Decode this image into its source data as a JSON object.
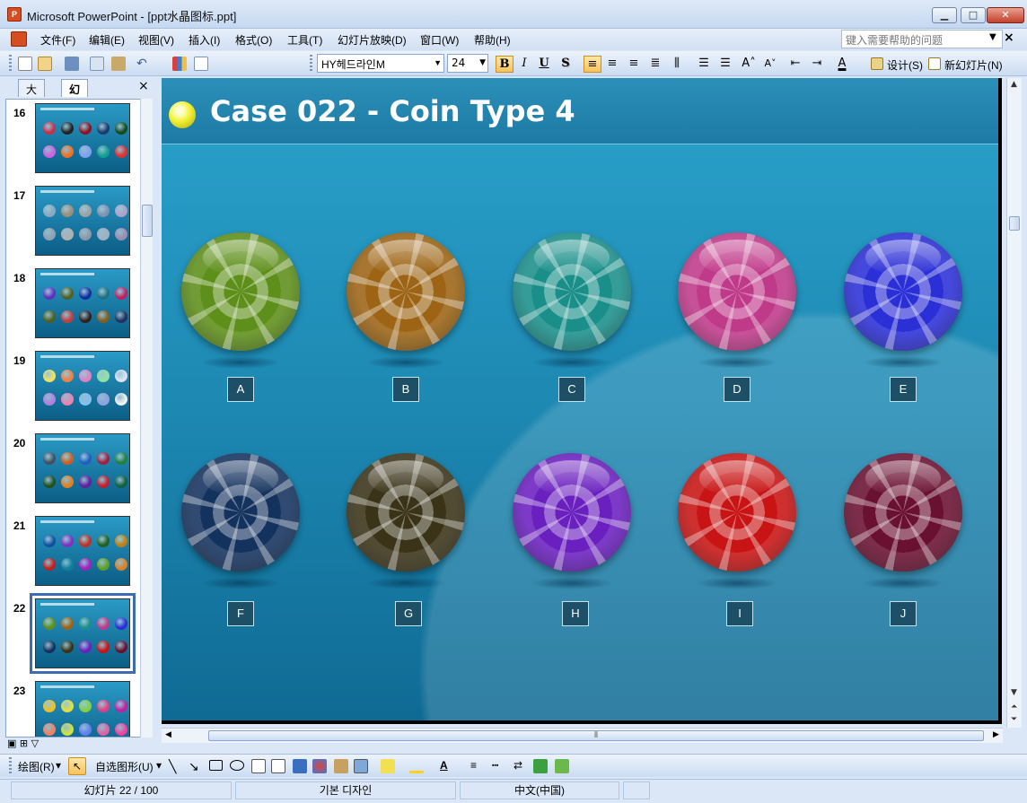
{
  "window": {
    "title": "Microsoft PowerPoint - [ppt水晶图标.ppt]",
    "app_icon": "powerpoint-icon",
    "buttons": {
      "minimize": "▁",
      "maximize": "□",
      "close": "✕"
    }
  },
  "menu": {
    "items": [
      "文件(F)",
      "编辑(E)",
      "视图(V)",
      "插入(I)",
      "格式(O)",
      "工具(T)",
      "幻灯片放映(D)",
      "窗口(W)",
      "帮助(H)"
    ],
    "help_placeholder": "键入需要帮助的问题",
    "close_glyph": "×"
  },
  "toolbar": {
    "font_name": "HY헤드라인M",
    "font_size": "24",
    "bold": "B",
    "italic": "I",
    "underline": "U",
    "shadow": "S",
    "design_label": "设计(S)",
    "new_slide_label": "新幻灯片(N)"
  },
  "panel": {
    "tabs": [
      "大纲",
      "幻灯片"
    ],
    "close_glyph": "×",
    "slides": [
      {
        "number": "16"
      },
      {
        "number": "17"
      },
      {
        "number": "18"
      },
      {
        "number": "19"
      },
      {
        "number": "20"
      },
      {
        "number": "21"
      },
      {
        "number": "22",
        "selected": true
      },
      {
        "number": "23"
      }
    ]
  },
  "slide": {
    "title": "Case 022 - Coin Type 4",
    "coins": [
      {
        "label": "A",
        "color": "#5e8f1a"
      },
      {
        "label": "B",
        "color": "#9c6414"
      },
      {
        "label": "C",
        "color": "#1a8f8a"
      },
      {
        "label": "D",
        "color": "#c03a8a"
      },
      {
        "label": "E",
        "color": "#2b2fd6"
      },
      {
        "label": "F",
        "color": "#14325e"
      },
      {
        "label": "G",
        "color": "#3a3318"
      },
      {
        "label": "H",
        "color": "#6a1fbf"
      },
      {
        "label": "I",
        "color": "#c81414"
      },
      {
        "label": "J",
        "color": "#6a1030"
      }
    ]
  },
  "drawbar": {
    "draw_label": "绘图(R)",
    "autoshape_label": "自选图形(U)"
  },
  "status": {
    "slide_position": "幻灯片 22 / 100",
    "design_name": "기본 디자인",
    "language": "中文(中国)"
  }
}
